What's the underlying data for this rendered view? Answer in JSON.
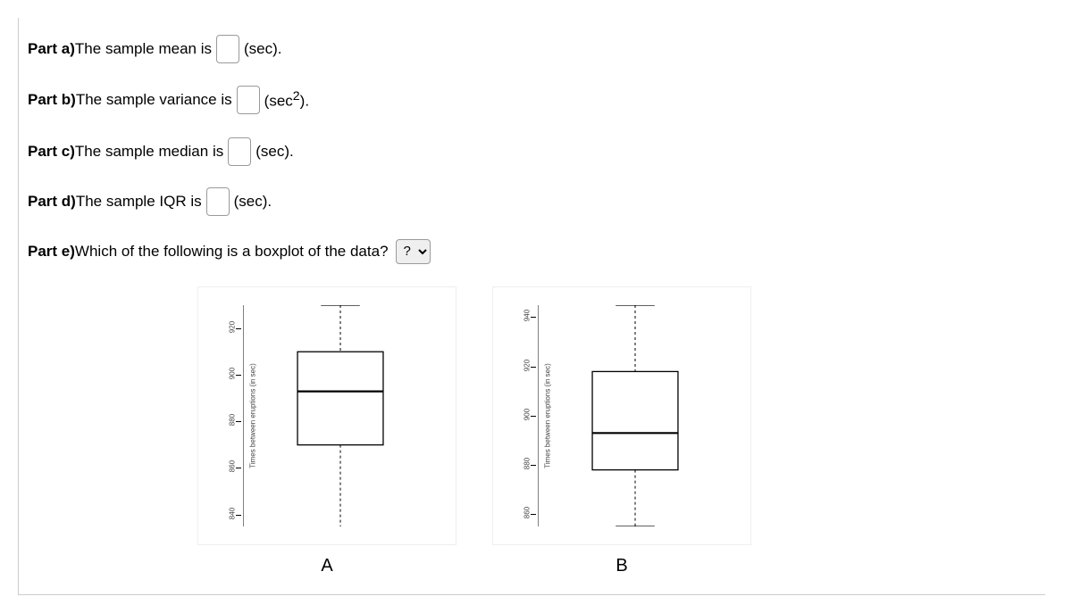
{
  "parts": {
    "a": {
      "label": "Part a)",
      "text1": " The sample mean is ",
      "unit": "(sec)."
    },
    "b": {
      "label": "Part b)",
      "text1": " The sample variance is ",
      "unit_pre": "(sec",
      "unit_sup": "2",
      "unit_post": ")."
    },
    "c": {
      "label": "Part c)",
      "text1": " The sample median is ",
      "unit": "(sec)."
    },
    "d": {
      "label": "Part d)",
      "text1": " The sample IQR is ",
      "unit": "(sec)."
    },
    "e": {
      "label": "Part e)",
      "text1": " Which of the following is a boxplot of the data?",
      "select_default": "?"
    }
  },
  "ylabel": "Times between eruptions (in sec)",
  "chart_data": [
    {
      "type": "boxplot",
      "label": "A",
      "ylabel": "Times between eruptions (in sec)",
      "ylim": [
        835,
        930
      ],
      "ticks": [
        840,
        860,
        880,
        900,
        920
      ],
      "min": 832,
      "q1": 870,
      "median": 893,
      "q3": 910,
      "max": 930
    },
    {
      "type": "boxplot",
      "label": "B",
      "ylabel": "Times between eruptions (in sec)",
      "ylim": [
        855,
        945
      ],
      "ticks": [
        860,
        880,
        900,
        920,
        940
      ],
      "min": 855,
      "q1": 878,
      "median": 893,
      "q3": 918,
      "max": 945
    }
  ]
}
